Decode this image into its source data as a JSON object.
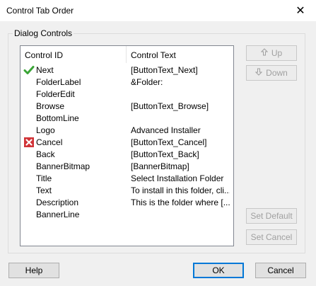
{
  "window": {
    "title": "Control Tab Order"
  },
  "group": {
    "label": "Dialog Controls"
  },
  "list": {
    "headers": {
      "id": "Control ID",
      "text": "Control Text"
    },
    "rows": [
      {
        "id": "Next",
        "text": "[ButtonText_Next]",
        "status": "check"
      },
      {
        "id": "FolderLabel",
        "text": "&Folder:",
        "status": ""
      },
      {
        "id": "FolderEdit",
        "text": "",
        "status": ""
      },
      {
        "id": "Browse",
        "text": "[ButtonText_Browse]",
        "status": ""
      },
      {
        "id": "BottomLine",
        "text": "",
        "status": ""
      },
      {
        "id": "Logo",
        "text": "Advanced Installer",
        "status": ""
      },
      {
        "id": "Cancel",
        "text": "[ButtonText_Cancel]",
        "status": "error"
      },
      {
        "id": "Back",
        "text": "[ButtonText_Back]",
        "status": ""
      },
      {
        "id": "BannerBitmap",
        "text": "[BannerBitmap]",
        "status": ""
      },
      {
        "id": "Title",
        "text": "Select Installation Folder",
        "status": ""
      },
      {
        "id": "Text",
        "text": "To install in this folder, cli...",
        "status": ""
      },
      {
        "id": "Description",
        "text": "This is the folder where [...",
        "status": ""
      },
      {
        "id": "BannerLine",
        "text": "",
        "status": ""
      }
    ]
  },
  "buttons": {
    "up": "Up",
    "down": "Down",
    "set_default": "Set Default",
    "set_cancel": "Set Cancel",
    "help": "Help",
    "ok": "OK",
    "cancel": "Cancel"
  },
  "colors": {
    "check": "#3aa536",
    "error": "#d13438",
    "accent": "#0078d7"
  }
}
